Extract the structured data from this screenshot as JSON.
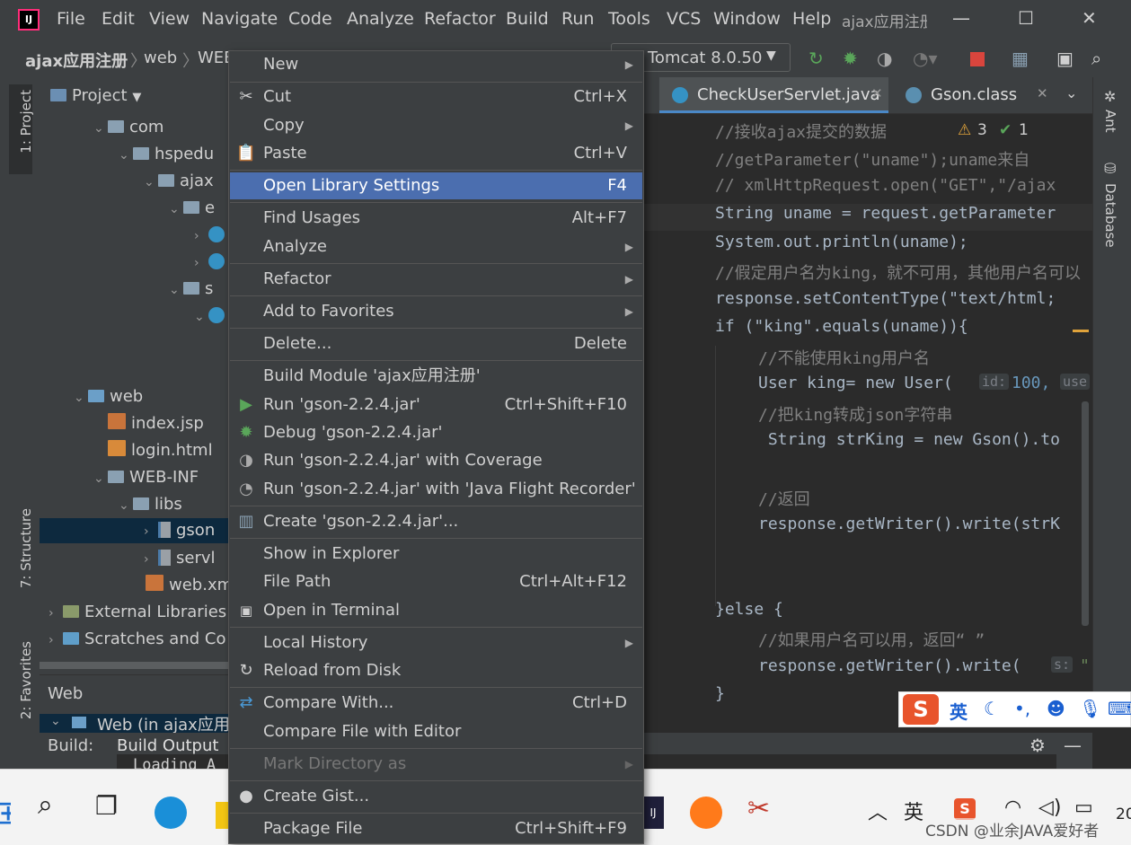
{
  "titlebar": {
    "menus": [
      "File",
      "Edit",
      "View",
      "Navigate",
      "Code",
      "Analyze",
      "Refactor",
      "Build",
      "Run",
      "Tools",
      "VCS",
      "Window",
      "Help"
    ],
    "project_title": "ajax应用注册",
    "minimize": "—",
    "maximize": "☐",
    "close": "✕"
  },
  "navbar": {
    "breadcrumbs": [
      "ajax应用注册",
      "web",
      "WEB"
    ],
    "run_config": "Tomcat 8.0.50"
  },
  "left_strip": {
    "tabs": [
      "1: Project",
      "7: Structure",
      "2: Favorites"
    ]
  },
  "project": {
    "header": "Project",
    "rows": [
      {
        "label": "com"
      },
      {
        "label": "hspedu"
      },
      {
        "label": "ajax"
      },
      {
        "label": "e"
      },
      {
        "label": ""
      },
      {
        "label": ""
      },
      {
        "label": "s"
      },
      {
        "label": ""
      },
      {
        "label": "web"
      },
      {
        "label": "index.jsp"
      },
      {
        "label": "login.html"
      },
      {
        "label": "WEB-INF"
      },
      {
        "label": "libs"
      },
      {
        "label": "gson"
      },
      {
        "label": "servl"
      },
      {
        "label": "web.xm"
      },
      {
        "label": "External Libraries"
      },
      {
        "label": "Scratches and Co"
      }
    ]
  },
  "editor": {
    "tabs": [
      "CheckUserServlet.java",
      "Gson.class"
    ],
    "warnings": "3",
    "ok_count": "1",
    "lines": [
      "//接收ajax提交的数据",
      "//getParameter(\"uname\");uname来自",
      "// xmlHttpRequest.open(\"GET\",\"/ajax",
      "String uname = request.getParameter",
      "System.out.println(uname);",
      "//假定用户名为king，就不可用，其他用户名可以",
      "response.setContentType(\"text/html;",
      "if (\"king\".equals(uname)){",
      "//不能使用king用户名",
      "User king= new User(",
      "//把king转成json字符串",
      " String strKing = new Gson().to",
      "//返回",
      "response.getWriter().write(strK",
      "}else {",
      "//如果用户名可以用，返回“ ”",
      "response.getWriter().write(",
      "}"
    ],
    "hint_id": "id:",
    "hint_id_val": "100,",
    "hint_use": "use",
    "hint_s": "s:",
    "hint_quote": "\""
  },
  "right_strip": {
    "tabs": [
      "Ant",
      "Database"
    ]
  },
  "web_panel": {
    "title": "Web",
    "row": "Web (in ajax应用注"
  },
  "build_panel": {
    "label": "Build:",
    "tab": "Build Output",
    "content": "Loading A"
  },
  "context_menu": {
    "items": [
      {
        "label": "New",
        "shortcut": "",
        "submenu": true,
        "icon": ""
      },
      {
        "label": "Cut",
        "shortcut": "Ctrl+X",
        "submenu": false,
        "icon": "scissors-icon"
      },
      {
        "label": "Copy",
        "shortcut": "",
        "submenu": true,
        "icon": ""
      },
      {
        "label": "Paste",
        "shortcut": "Ctrl+V",
        "submenu": false,
        "icon": "paste-icon"
      },
      {
        "label": "Open Library Settings",
        "shortcut": "F4",
        "submenu": false,
        "icon": "",
        "selected": true
      },
      {
        "label": "Find Usages",
        "shortcut": "Alt+F7",
        "submenu": false,
        "icon": ""
      },
      {
        "label": "Analyze",
        "shortcut": "",
        "submenu": true,
        "icon": ""
      },
      {
        "label": "Refactor",
        "shortcut": "",
        "submenu": true,
        "icon": ""
      },
      {
        "label": "Add to Favorites",
        "shortcut": "",
        "submenu": true,
        "icon": ""
      },
      {
        "label": "Delete...",
        "shortcut": "Delete",
        "submenu": false,
        "icon": ""
      },
      {
        "label": "Build Module 'ajax应用注册'",
        "shortcut": "",
        "submenu": false,
        "icon": ""
      },
      {
        "label": "Run 'gson-2.2.4.jar'",
        "shortcut": "Ctrl+Shift+F10",
        "submenu": false,
        "icon": "run-icon"
      },
      {
        "label": "Debug 'gson-2.2.4.jar'",
        "shortcut": "",
        "submenu": false,
        "icon": "debug-icon"
      },
      {
        "label": "Run 'gson-2.2.4.jar' with Coverage",
        "shortcut": "",
        "submenu": false,
        "icon": "coverage-icon"
      },
      {
        "label": "Run 'gson-2.2.4.jar' with 'Java Flight Recorder'",
        "shortcut": "",
        "submenu": false,
        "icon": "profiler-icon"
      },
      {
        "label": "Create 'gson-2.2.4.jar'...",
        "shortcut": "",
        "submenu": false,
        "icon": "create-config-icon"
      },
      {
        "label": "Show in Explorer",
        "shortcut": "",
        "submenu": false,
        "icon": ""
      },
      {
        "label": "File Path",
        "shortcut": "Ctrl+Alt+F12",
        "submenu": false,
        "icon": ""
      },
      {
        "label": "Open in Terminal",
        "shortcut": "",
        "submenu": false,
        "icon": "terminal-icon"
      },
      {
        "label": "Local History",
        "shortcut": "",
        "submenu": true,
        "icon": ""
      },
      {
        "label": "Reload from Disk",
        "shortcut": "",
        "submenu": false,
        "icon": "reload-icon"
      },
      {
        "label": "Compare With...",
        "shortcut": "Ctrl+D",
        "submenu": false,
        "icon": "compare-icon"
      },
      {
        "label": "Compare File with Editor",
        "shortcut": "",
        "submenu": false,
        "icon": ""
      },
      {
        "label": "Mark Directory as",
        "shortcut": "",
        "submenu": true,
        "icon": "",
        "disabled": true
      },
      {
        "label": "Create Gist...",
        "shortcut": "",
        "submenu": false,
        "icon": "github-icon"
      },
      {
        "label": "Package File",
        "shortcut": "Ctrl+Shift+F9",
        "submenu": false,
        "icon": ""
      }
    ]
  },
  "ime": {
    "mode": "英"
  },
  "taskbar": {
    "lang": "英",
    "watermark": "CSDN @业余JAVA爱好者",
    "clock_partial": "20"
  },
  "colors": {
    "selection": "#4b6eaf",
    "background": "#2b2b2b",
    "panel": "#3c3f41"
  }
}
